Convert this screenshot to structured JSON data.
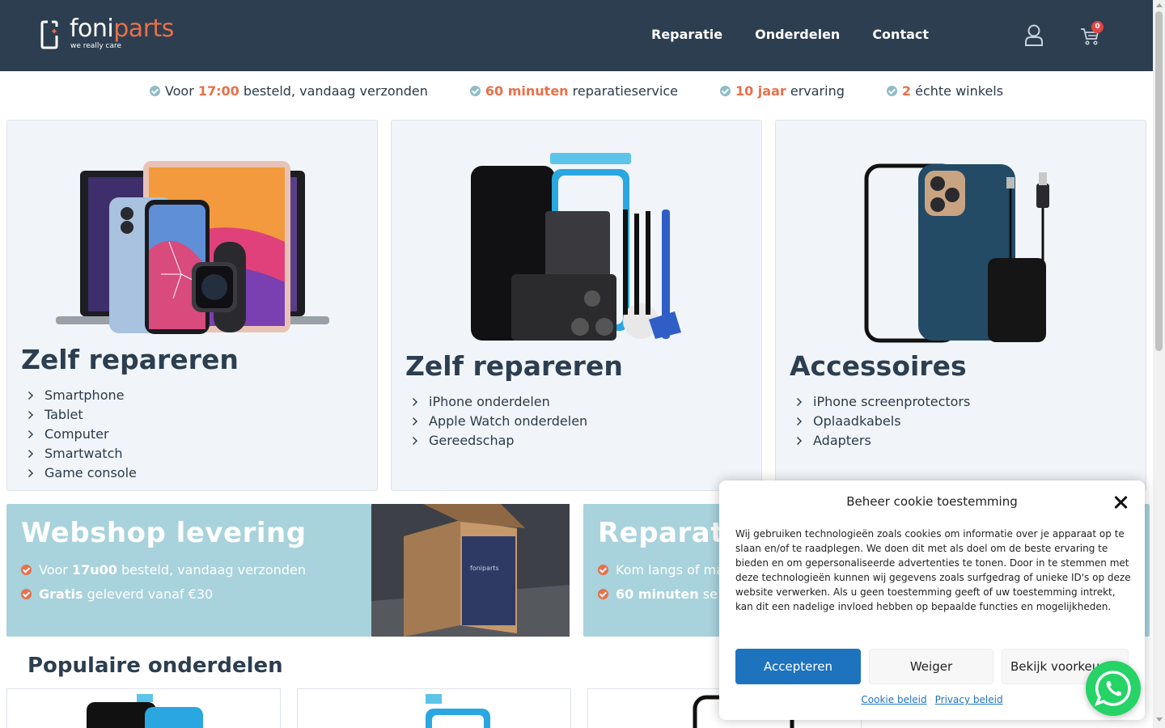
{
  "header": {
    "logo_text_a": "foni",
    "logo_text_b": "parts",
    "logo_tagline": "we really care",
    "nav": [
      "Reparatie",
      "Onderdelen",
      "Contact"
    ],
    "cart_count": "0",
    "icons": [
      "user-icon",
      "cart-icon"
    ]
  },
  "usps": [
    {
      "pre": "Voor ",
      "hl": "17:00",
      "post": " besteld, vandaag verzonden"
    },
    {
      "pre": "",
      "hl": "60 minuten",
      "post": " reparatieservice"
    },
    {
      "pre": "",
      "hl": "10 jaar",
      "post": " ervaring"
    },
    {
      "pre": "",
      "hl": "2",
      "post": " échte winkels"
    }
  ],
  "categories": [
    {
      "title": "Zelf repareren",
      "items": [
        "Smartphone",
        "Tablet",
        "Computer",
        "Smartwatch",
        "Game console"
      ]
    },
    {
      "title": "Zelf repareren",
      "items": [
        "iPhone onderdelen",
        "Apple Watch onderdelen",
        "Gereedschap"
      ]
    },
    {
      "title": "Accessoires",
      "items": [
        "iPhone screenprotectors",
        "Oplaadkabels",
        "Adapters"
      ]
    }
  ],
  "banners": {
    "webshop": {
      "title": "Webshop levering",
      "line1_pre": "Voor ",
      "line1_b": "17u00",
      "line1_post": " besteld, vandaag verzonden",
      "line2_b": "Gratis",
      "line2_post": " geleverd vanaf €30"
    },
    "reparatie": {
      "title": "Reparati",
      "line1": "Kom langs of ma",
      "line2_b": "60 minuten",
      "line2_post": " se"
    },
    "box_brand": "foniparts"
  },
  "popular": {
    "title": "Populaire onderdelen"
  },
  "cookie": {
    "title": "Beheer cookie toestemming",
    "text": "Wij gebruiken technologieën zoals cookies om informatie over je apparaat op te slaan en/of te raadplegen. We doen dit met als doel om de beste ervaring te bieden en om gepersonaliseerde advertenties te tonen. Door in te stemmen met deze technologieën kunnen wij gegevens zoals surfgedrag of unieke ID's op deze website verwerken. Als u geen toestemming geeft of uw toestemming intrekt, kan dit een nadelige invloed hebben op bepaalde functies en mogelijkheden.",
    "accept": "Accepteren",
    "deny": "Weiger",
    "prefs": "Bekijk voorkeuren",
    "link1": "Cookie beleid",
    "link2": "Privacy beleid"
  },
  "colors": {
    "header_bg": "#2c3e50",
    "accent": "#e8704a",
    "banner_bg": "#a8d2dc",
    "primary_button": "#1e73be",
    "whatsapp": "#25d366"
  }
}
